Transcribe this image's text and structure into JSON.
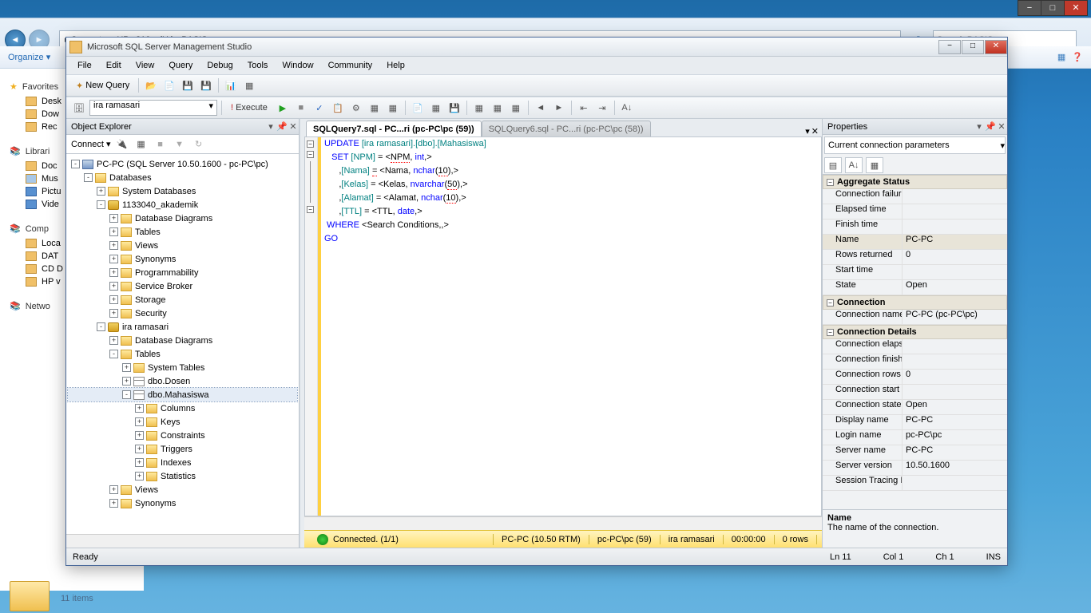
{
  "desktop": {
    "win_buttons": [
      "−",
      "□",
      "✕"
    ],
    "breadcrumb": [
      "Computer",
      "HP v210w (H:)",
      "BASIS"
    ],
    "search_placeholder": "Search BASIS",
    "organize": "Organize ▾",
    "items_count": "11 items",
    "sidebar": [
      {
        "type": "header",
        "icon": "star",
        "label": "Favorites"
      },
      {
        "icon": "folder",
        "label": "Desk"
      },
      {
        "icon": "folder",
        "label": "Dow"
      },
      {
        "icon": "folder",
        "label": "Rec"
      },
      {
        "type": "gap"
      },
      {
        "type": "header",
        "icon": "blue",
        "label": "Librari"
      },
      {
        "icon": "folder",
        "label": "Doc"
      },
      {
        "icon": "music",
        "label": "Mus"
      },
      {
        "icon": "blue",
        "label": "Pictu"
      },
      {
        "icon": "blue",
        "label": "Vide"
      },
      {
        "type": "gap"
      },
      {
        "type": "header",
        "icon": "blue",
        "label": "Comp"
      },
      {
        "icon": "folder",
        "label": "Loca"
      },
      {
        "icon": "folder",
        "label": "DAT"
      },
      {
        "icon": "folder",
        "label": "CD D"
      },
      {
        "icon": "folder",
        "label": "HP v"
      },
      {
        "type": "gap"
      },
      {
        "type": "header",
        "icon": "blue",
        "label": "Netwo"
      }
    ]
  },
  "ssms": {
    "title": "Microsoft SQL Server Management Studio",
    "menus": [
      "File",
      "Edit",
      "View",
      "Query",
      "Debug",
      "Tools",
      "Window",
      "Community",
      "Help"
    ],
    "new_query": "New Query",
    "db_selected": "ira ramasari",
    "execute": "Execute",
    "object_explorer": {
      "title": "Object Explorer",
      "connect": "Connect ▾",
      "tree": [
        {
          "d": 0,
          "e": "-",
          "i": "server",
          "t": "PC-PC (SQL Server 10.50.1600 - pc-PC\\pc)"
        },
        {
          "d": 1,
          "e": "-",
          "i": "folder",
          "t": "Databases"
        },
        {
          "d": 2,
          "e": "+",
          "i": "folder",
          "t": "System Databases"
        },
        {
          "d": 2,
          "e": "-",
          "i": "db",
          "t": "1133040_akademik"
        },
        {
          "d": 3,
          "e": "+",
          "i": "folder",
          "t": "Database Diagrams"
        },
        {
          "d": 3,
          "e": "+",
          "i": "folder",
          "t": "Tables"
        },
        {
          "d": 3,
          "e": "+",
          "i": "folder",
          "t": "Views"
        },
        {
          "d": 3,
          "e": "+",
          "i": "folder",
          "t": "Synonyms"
        },
        {
          "d": 3,
          "e": "+",
          "i": "folder",
          "t": "Programmability"
        },
        {
          "d": 3,
          "e": "+",
          "i": "folder",
          "t": "Service Broker"
        },
        {
          "d": 3,
          "e": "+",
          "i": "folder",
          "t": "Storage"
        },
        {
          "d": 3,
          "e": "+",
          "i": "folder",
          "t": "Security"
        },
        {
          "d": 2,
          "e": "-",
          "i": "db",
          "t": "ira ramasari"
        },
        {
          "d": 3,
          "e": "+",
          "i": "folder",
          "t": "Database Diagrams"
        },
        {
          "d": 3,
          "e": "-",
          "i": "folder",
          "t": "Tables"
        },
        {
          "d": 4,
          "e": "+",
          "i": "folder",
          "t": "System Tables"
        },
        {
          "d": 4,
          "e": "+",
          "i": "table",
          "t": "dbo.Dosen"
        },
        {
          "d": 4,
          "e": "-",
          "i": "table",
          "t": "dbo.Mahasiswa",
          "sel": true
        },
        {
          "d": 5,
          "e": "+",
          "i": "folder",
          "t": "Columns"
        },
        {
          "d": 5,
          "e": "+",
          "i": "folder",
          "t": "Keys"
        },
        {
          "d": 5,
          "e": "+",
          "i": "folder",
          "t": "Constraints"
        },
        {
          "d": 5,
          "e": "+",
          "i": "folder",
          "t": "Triggers"
        },
        {
          "d": 5,
          "e": "+",
          "i": "folder",
          "t": "Indexes"
        },
        {
          "d": 5,
          "e": "+",
          "i": "folder",
          "t": "Statistics"
        },
        {
          "d": 3,
          "e": "+",
          "i": "folder",
          "t": "Views"
        },
        {
          "d": 3,
          "e": "+",
          "i": "folder",
          "t": "Synonyms"
        }
      ]
    },
    "tabs": [
      {
        "label": "SQLQuery7.sql - PC...ri (pc-PC\\pc (59))",
        "active": true
      },
      {
        "label": "SQLQuery6.sql - PC...ri (pc-PC\\pc (58))",
        "active": false
      }
    ],
    "sql_lines": [
      {
        "t": "UPDATE",
        "c": "kw"
      },
      {
        "t": " [ira ramasari].[dbo].[Mahasiswa]\n",
        "c": "obj"
      },
      {
        "t": "   SET",
        "c": "kw"
      },
      {
        "t": " [NPM] ",
        "c": "obj"
      },
      {
        "t": "=",
        "c": ""
      },
      {
        "t": " <",
        "c": ""
      },
      {
        "t": "NPM",
        "c": "sqig"
      },
      {
        "t": ",",
        "c": ""
      },
      {
        "t": " int",
        "c": "kw"
      },
      {
        "t": ",>\n",
        "c": ""
      },
      {
        "t": "      ,",
        "c": ""
      },
      {
        "t": "[Nama]",
        "c": "obj"
      },
      {
        "t": " ",
        "c": ""
      },
      {
        "t": "=",
        "c": "sqig"
      },
      {
        "t": " <Nama",
        "c": ""
      },
      {
        "t": ",",
        "c": ""
      },
      {
        "t": " nchar",
        "c": "kw"
      },
      {
        "t": "(",
        "c": ""
      },
      {
        "t": "10",
        "c": "sqig"
      },
      {
        "t": ")",
        "c": ""
      },
      {
        "t": ",>\n",
        "c": ""
      },
      {
        "t": "      ,",
        "c": ""
      },
      {
        "t": "[Kelas]",
        "c": "obj"
      },
      {
        "t": " = <Kelas",
        "c": ""
      },
      {
        "t": ",",
        "c": ""
      },
      {
        "t": " nvarchar",
        "c": "kw"
      },
      {
        "t": "(",
        "c": ""
      },
      {
        "t": "50",
        "c": "sqig"
      },
      {
        "t": ")",
        "c": ""
      },
      {
        "t": ",>\n",
        "c": ""
      },
      {
        "t": "      ,",
        "c": ""
      },
      {
        "t": "[Alamat]",
        "c": "obj"
      },
      {
        "t": " = <Alamat",
        "c": ""
      },
      {
        "t": ",",
        "c": ""
      },
      {
        "t": " nchar",
        "c": "kw"
      },
      {
        "t": "(",
        "c": ""
      },
      {
        "t": "10",
        "c": "sqig"
      },
      {
        "t": ")",
        "c": ""
      },
      {
        "t": ",>\n",
        "c": ""
      },
      {
        "t": "      ,",
        "c": ""
      },
      {
        "t": "[TTL]",
        "c": "obj"
      },
      {
        "t": " = <TTL",
        "c": ""
      },
      {
        "t": ",",
        "c": ""
      },
      {
        "t": " date",
        "c": "kw"
      },
      {
        "t": ",>\n",
        "c": ""
      },
      {
        "t": " WHERE",
        "c": "kw"
      },
      {
        "t": " <Search Conditions,,>\n",
        "c": ""
      },
      {
        "t": "GO",
        "c": "kw"
      }
    ],
    "status_yellow": {
      "connected": "Connected. (1/1)",
      "server": "PC-PC (10.50 RTM)",
      "user": "pc-PC\\pc (59)",
      "db": "ira ramasari",
      "time": "00:00:00",
      "rows": "0 rows"
    },
    "properties": {
      "title": "Properties",
      "dropdown": "Current connection parameters",
      "cats": [
        {
          "name": "Aggregate Status",
          "rows": [
            {
              "k": "Connection failur",
              "v": ""
            },
            {
              "k": "Elapsed time",
              "v": ""
            },
            {
              "k": "Finish time",
              "v": ""
            },
            {
              "k": "Name",
              "v": "PC-PC",
              "sel": true
            },
            {
              "k": "Rows returned",
              "v": "0"
            },
            {
              "k": "Start time",
              "v": ""
            },
            {
              "k": "State",
              "v": "Open"
            }
          ]
        },
        {
          "name": "Connection",
          "rows": [
            {
              "k": "Connection name",
              "v": "PC-PC (pc-PC\\pc)"
            }
          ]
        },
        {
          "name": "Connection Details",
          "rows": [
            {
              "k": "Connection elaps",
              "v": ""
            },
            {
              "k": "Connection finish",
              "v": ""
            },
            {
              "k": "Connection rows",
              "v": "0"
            },
            {
              "k": "Connection start",
              "v": ""
            },
            {
              "k": "Connection state",
              "v": "Open"
            },
            {
              "k": "Display name",
              "v": "PC-PC"
            },
            {
              "k": "Login name",
              "v": "pc-PC\\pc"
            },
            {
              "k": "Server name",
              "v": "PC-PC"
            },
            {
              "k": "Server version",
              "v": "10.50.1600"
            },
            {
              "k": "Session Tracing ID",
              "v": ""
            }
          ]
        }
      ],
      "desc_title": "Name",
      "desc_text": "The name of the connection."
    },
    "statusbar": {
      "ready": "Ready",
      "ln": "Ln 11",
      "col": "Col 1",
      "ch": "Ch 1",
      "ins": "INS"
    }
  }
}
